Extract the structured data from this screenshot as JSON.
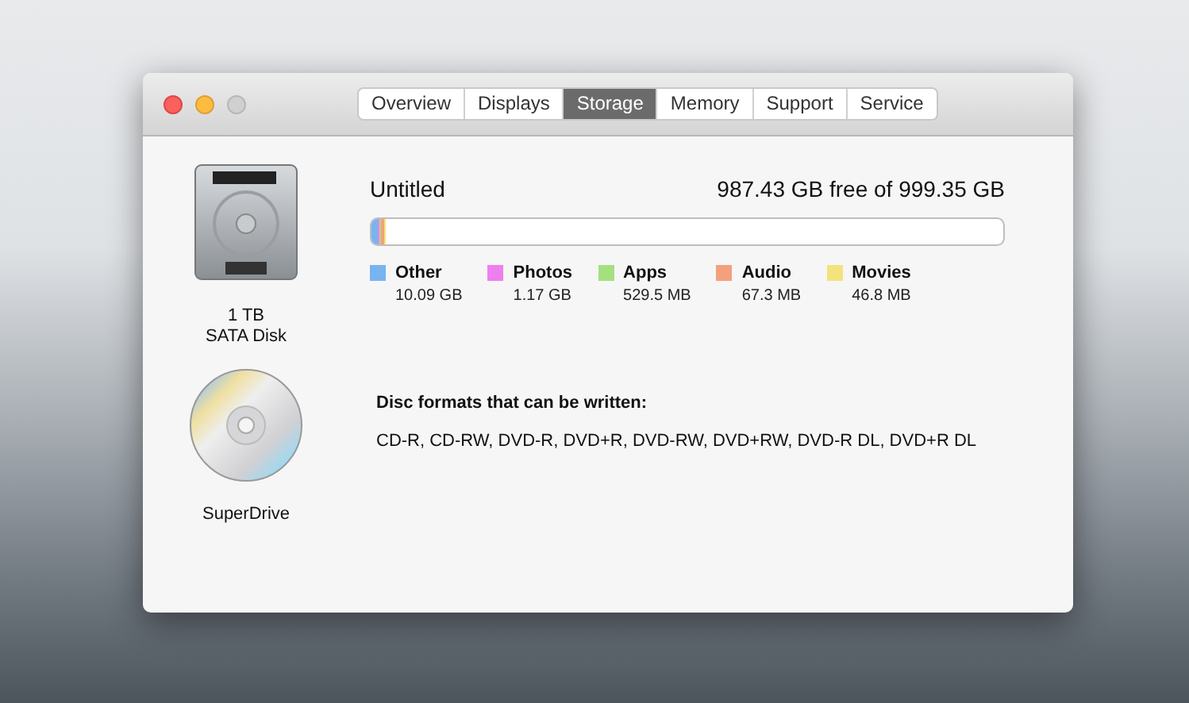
{
  "window": {
    "tabs": [
      {
        "label": "Overview",
        "selected": false
      },
      {
        "label": "Displays",
        "selected": false
      },
      {
        "label": "Storage",
        "selected": true
      },
      {
        "label": "Memory",
        "selected": false
      },
      {
        "label": "Support",
        "selected": false
      },
      {
        "label": "Service",
        "selected": false
      }
    ]
  },
  "disk": {
    "label_lines": [
      "1 TB",
      "SATA Disk"
    ],
    "volume": "Untitled",
    "free": "987.43 GB free of 999.35 GB",
    "categories": [
      {
        "name": "Other",
        "size": "10.09 GB",
        "color": "#78b4f0",
        "level": 0.0101
      },
      {
        "name": "Photos",
        "size": "1.17 GB",
        "color": "#ee7fee",
        "level": 0.0012
      },
      {
        "name": "Apps",
        "size": "529.5 MB",
        "color": "#a4e080",
        "level": 0.0005
      },
      {
        "name": "Audio",
        "size": "67.3 MB",
        "color": "#f4a07c",
        "level": 0.0001
      },
      {
        "name": "Movies",
        "size": "46.8 MB",
        "color": "#f4e27c",
        "level": 0.0001
      }
    ]
  },
  "drive": {
    "label": "SuperDrive",
    "heading": "Disc formats that can be written:",
    "formats": "CD-R, CD-RW, DVD-R, DVD+R, DVD-RW, DVD+RW, DVD-R DL, DVD+R DL"
  }
}
